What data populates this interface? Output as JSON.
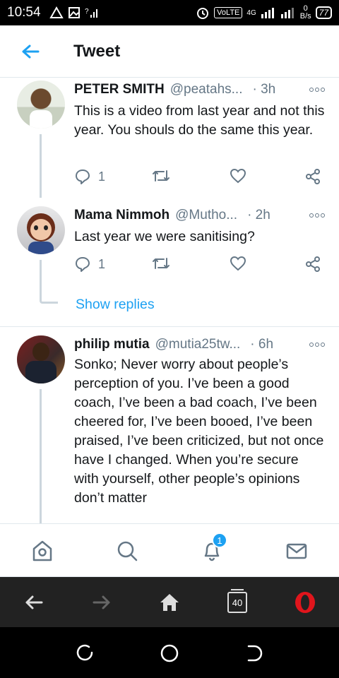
{
  "status_bar": {
    "time": "10:54",
    "network_label": "VoLTE",
    "network_gen": "4G",
    "data_rate": "0",
    "data_unit": "B/s",
    "battery": "77"
  },
  "header": {
    "title": "Tweet",
    "back_icon": "arrow-left-icon"
  },
  "tweets": [
    {
      "name": "PETER SMITH",
      "handle": "@peatahs...",
      "time": "· 3h",
      "text": "This is a video from last year and not this year. You shouls do the same this year.",
      "reply_count": "1"
    },
    {
      "name": "Mama Nimmoh",
      "handle": "@Mutho...",
      "time": "· 2h",
      "text": "Last year we were sanitising?",
      "reply_count": "1"
    },
    {
      "name": "philip mutia",
      "handle": "@mutia25tw...",
      "time": "· 6h",
      "text": "Sonko; Never worry about people’s perception of you. I’ve been a good coach, I’ve been a bad coach, I’ve been cheered for, I’ve been booed, I’ve been praised, I’ve been criticized, but not once have I changed. When you’re secure with yourself, other people’s opinions don’t matter"
    }
  ],
  "show_replies_label": "Show replies",
  "bottom_nav": {
    "notification_badge": "1",
    "items": [
      "home-icon",
      "search-icon",
      "notifications-icon",
      "messages-icon"
    ]
  },
  "browser_bar": {
    "tab_count": "40"
  },
  "colors": {
    "accent": "#1da1f2",
    "secondary_text": "#657786",
    "opera_red": "#e0151c"
  }
}
